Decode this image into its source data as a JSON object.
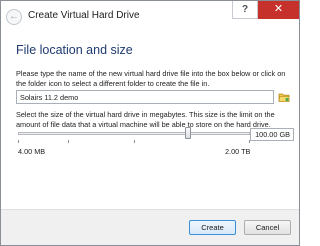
{
  "window": {
    "title": "Create Virtual Hard Drive",
    "help_label": "?",
    "close_label": "✕"
  },
  "section": {
    "title": "File location and size"
  },
  "location": {
    "instructions": "Please type the name of the new virtual hard drive file into the box below or click on the folder icon to select a different folder to create the file in.",
    "file_name": "Solairs 11.2 demo"
  },
  "size": {
    "instructions": "Select the size of the virtual hard drive in megabytes. This size is the limit on the amount of file data that a virtual machine will be able to store on the hard drive.",
    "value": "100.00 GB",
    "min_label": "4.00 MB",
    "max_label": "2.00 TB"
  },
  "buttons": {
    "create": "Create",
    "cancel": "Cancel"
  },
  "colors": {
    "title_accent": "#1e3a6e",
    "close_button": "#c7312b",
    "default_button_border": "#3c8fd9"
  }
}
